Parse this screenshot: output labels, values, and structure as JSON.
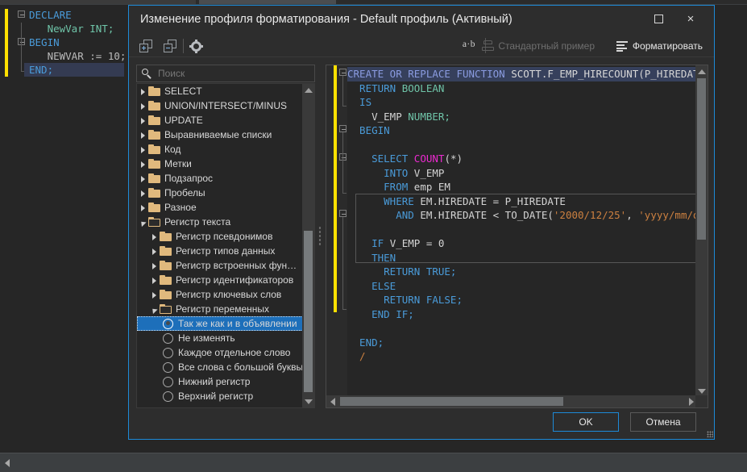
{
  "background_editor": {
    "lines": [
      {
        "text": "DECLARE",
        "kind": "kw"
      },
      {
        "text": "   NewVar INT;",
        "kind": "decl"
      },
      {
        "text": "BEGIN",
        "kind": "kw"
      },
      {
        "text": "   NEWVAR := 10;",
        "kind": "stmt"
      },
      {
        "text": "END;",
        "kind": "kw",
        "current": true
      }
    ]
  },
  "dialog": {
    "title": "Изменение профиля форматирования - Default профиль (Активный)",
    "window_controls": {
      "maximize": "maximize-icon",
      "close": "×"
    },
    "toolbar": {
      "add_icon": "copy-add-icon",
      "delete_icon": "copy-remove-icon",
      "settings_icon": "gear-icon",
      "ab_label": "a·b",
      "sample_label": "Стандартный пример",
      "sample_icon": "stamp-icon",
      "format_label": "Форматировать",
      "format_icon": "format-lines-icon"
    },
    "search": {
      "placeholder": "Поиск",
      "value": "",
      "icon": "search-icon"
    },
    "tree": [
      {
        "label": "SELECT",
        "type": "folder",
        "indent": 0,
        "state": "collapsed"
      },
      {
        "label": "UNION/INTERSECT/MINUS",
        "type": "folder",
        "indent": 0,
        "state": "collapsed"
      },
      {
        "label": "UPDATE",
        "type": "folder",
        "indent": 0,
        "state": "collapsed"
      },
      {
        "label": "Выравниваемые списки",
        "type": "folder",
        "indent": 0,
        "state": "collapsed"
      },
      {
        "label": "Код",
        "type": "folder",
        "indent": 0,
        "state": "collapsed"
      },
      {
        "label": "Метки",
        "type": "folder",
        "indent": 0,
        "state": "collapsed"
      },
      {
        "label": "Подзапрос",
        "type": "folder",
        "indent": 0,
        "state": "collapsed"
      },
      {
        "label": "Пробелы",
        "type": "folder",
        "indent": 0,
        "state": "collapsed"
      },
      {
        "label": "Разное",
        "type": "folder",
        "indent": 0,
        "state": "collapsed"
      },
      {
        "label": "Регистр текста",
        "type": "folder",
        "indent": 0,
        "state": "expanded"
      },
      {
        "label": "Регистр псевдонимов",
        "type": "folder",
        "indent": 1,
        "state": "collapsed"
      },
      {
        "label": "Регистр типов данных",
        "type": "folder",
        "indent": 1,
        "state": "collapsed"
      },
      {
        "label": "Регистр встроенных фун…",
        "type": "folder",
        "indent": 1,
        "state": "collapsed"
      },
      {
        "label": "Регистр идентификаторов",
        "type": "folder",
        "indent": 1,
        "state": "collapsed"
      },
      {
        "label": "Регистр ключевых слов",
        "type": "folder",
        "indent": 1,
        "state": "collapsed"
      },
      {
        "label": "Регистр переменных",
        "type": "folder",
        "indent": 1,
        "state": "expanded"
      },
      {
        "label": "Так же как и в объявлении",
        "type": "radio",
        "indent": 2,
        "selected": true
      },
      {
        "label": "Не изменять",
        "type": "radio",
        "indent": 2,
        "selected": false
      },
      {
        "label": "Каждое отдельное слово",
        "type": "radio",
        "indent": 2,
        "selected": false
      },
      {
        "label": "Все слова с большой буквы",
        "type": "radio",
        "indent": 2,
        "selected": false
      },
      {
        "label": "Нижний регистр",
        "type": "radio",
        "indent": 2,
        "selected": false
      },
      {
        "label": "Верхний регистр",
        "type": "radio",
        "indent": 2,
        "selected": false
      }
    ],
    "code_preview": {
      "lines": [
        [
          {
            "t": "CREATE OR REPLACE FUNCTION ",
            "c": "c-kw2"
          },
          {
            "t": "SCOTT.F_EMP_HIRECOUNT",
            "c": "c-fn"
          },
          {
            "t": "(",
            "c": "c-pl"
          },
          {
            "t": "P_HIREDATE ",
            "c": "c-pl"
          }
        ],
        [
          {
            "t": "  RETURN ",
            "c": "c-kw"
          },
          {
            "t": "BOOLEAN",
            "c": "c-ty"
          }
        ],
        [
          {
            "t": "  IS",
            "c": "c-kw"
          }
        ],
        [
          {
            "t": "    V_EMP ",
            "c": "c-pl"
          },
          {
            "t": "NUMBER",
            "c": "c-ty"
          },
          {
            "t": ";",
            "c": "c-ty"
          }
        ],
        [
          {
            "t": "  BEGIN",
            "c": "c-kw"
          }
        ],
        [
          {
            "t": "",
            "c": "c-pl"
          }
        ],
        [
          {
            "t": "    SELECT ",
            "c": "c-kw"
          },
          {
            "t": "COUNT",
            "c": "c-agg"
          },
          {
            "t": "(*)",
            "c": "c-pl"
          }
        ],
        [
          {
            "t": "      INTO ",
            "c": "c-kw"
          },
          {
            "t": "V_EMP",
            "c": "c-pl"
          }
        ],
        [
          {
            "t": "      FROM ",
            "c": "c-kw"
          },
          {
            "t": "emp EM",
            "c": "c-pl"
          }
        ],
        [
          {
            "t": "      WHERE ",
            "c": "c-kw"
          },
          {
            "t": "EM.HIREDATE = P_HIREDATE",
            "c": "c-pl"
          }
        ],
        [
          {
            "t": "        AND ",
            "c": "c-kw"
          },
          {
            "t": "EM.HIREDATE < ",
            "c": "c-pl"
          },
          {
            "t": "TO_DATE",
            "c": "c-pl"
          },
          {
            "t": "(",
            "c": "c-pl"
          },
          {
            "t": "'2000/12/25'",
            "c": "c-str"
          },
          {
            "t": ", ",
            "c": "c-pl"
          },
          {
            "t": "'yyyy/mm/dd'",
            "c": "c-str"
          }
        ],
        [
          {
            "t": "",
            "c": "c-pl"
          }
        ],
        [
          {
            "t": "    IF ",
            "c": "c-kw"
          },
          {
            "t": "V_EMP = 0",
            "c": "c-pl"
          }
        ],
        [
          {
            "t": "    THEN",
            "c": "c-kw"
          }
        ],
        [
          {
            "t": "      RETURN TRUE;",
            "c": "c-kw"
          }
        ],
        [
          {
            "t": "    ELSE",
            "c": "c-kw"
          }
        ],
        [
          {
            "t": "      RETURN FALSE;",
            "c": "c-kw"
          }
        ],
        [
          {
            "t": "    END IF;",
            "c": "c-kw"
          }
        ],
        [
          {
            "t": "",
            "c": "c-pl"
          }
        ],
        [
          {
            "t": "  END;",
            "c": "c-kw"
          }
        ],
        [
          {
            "t": "  /",
            "c": "c-str"
          }
        ]
      ]
    },
    "footer": {
      "ok_label": "OK",
      "cancel_label": "Отмена"
    }
  }
}
